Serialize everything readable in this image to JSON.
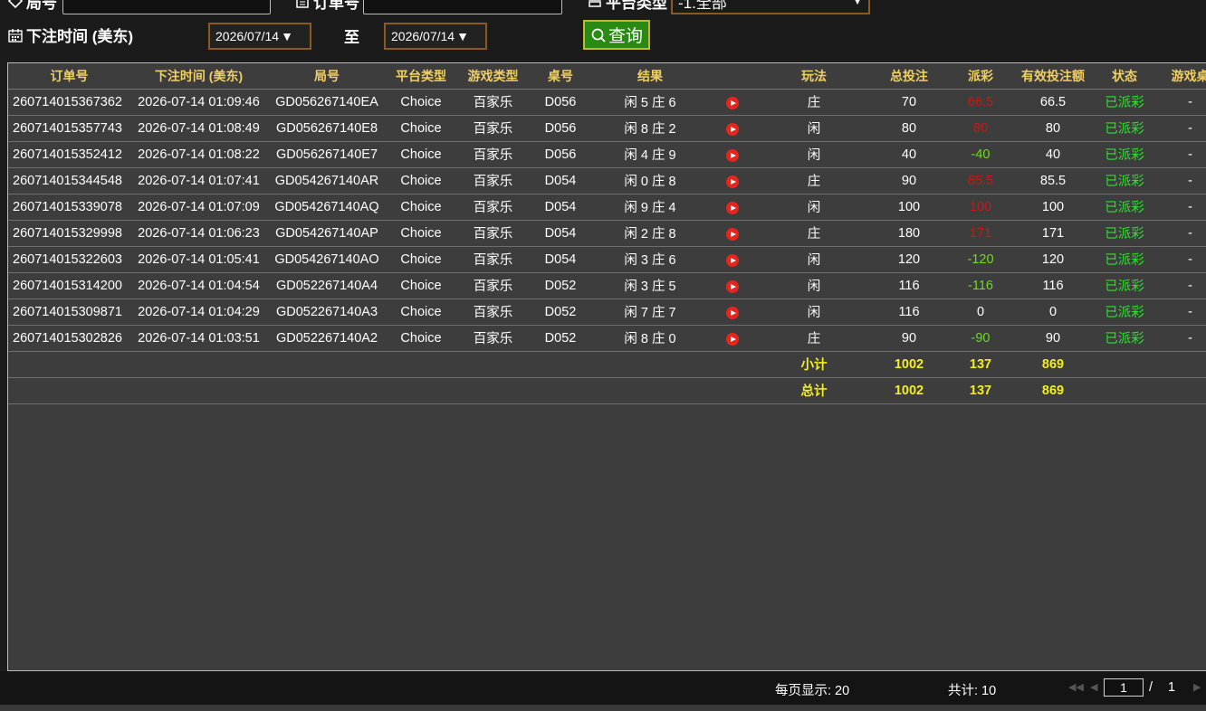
{
  "filters": {
    "round_label": "局号",
    "order_label": "订单号",
    "platform_label": "平台类型",
    "platform_value": "-1.全部",
    "time_label": "下注时间 (美东)",
    "date_from": "2026/07/14",
    "to_label": "至",
    "date_to": "2026/07/14",
    "query_label": "查询"
  },
  "table": {
    "columns": [
      "订单号",
      "下注时间 (美东)",
      "局号",
      "平台类型",
      "游戏类型",
      "桌号",
      "结果",
      "",
      "玩法",
      "总投注",
      "派彩",
      "有效投注额",
      "状态",
      "游戏桌"
    ],
    "rows": [
      {
        "order": "260714015367362",
        "time": "2026-07-14 01:09:46",
        "round": "GD056267140EA",
        "platform": "Choice",
        "game": "百家乐",
        "table": "D056",
        "result": "闲 5 庄 6",
        "play": "庄",
        "bet": "70",
        "payout": "66.5",
        "payout_type": "pos",
        "valid": "66.5",
        "status": "已派彩",
        "desk": "-"
      },
      {
        "order": "260714015357743",
        "time": "2026-07-14 01:08:49",
        "round": "GD056267140E8",
        "platform": "Choice",
        "game": "百家乐",
        "table": "D056",
        "result": "闲 8 庄 2",
        "play": "闲",
        "bet": "80",
        "payout": "80",
        "payout_type": "pos",
        "valid": "80",
        "status": "已派彩",
        "desk": "-"
      },
      {
        "order": "260714015352412",
        "time": "2026-07-14 01:08:22",
        "round": "GD056267140E7",
        "platform": "Choice",
        "game": "百家乐",
        "table": "D056",
        "result": "闲 4 庄 9",
        "play": "闲",
        "bet": "40",
        "payout": "-40",
        "payout_type": "neg",
        "valid": "40",
        "status": "已派彩",
        "desk": "-"
      },
      {
        "order": "260714015344548",
        "time": "2026-07-14 01:07:41",
        "round": "GD054267140AR",
        "platform": "Choice",
        "game": "百家乐",
        "table": "D054",
        "result": "闲 0 庄 8",
        "play": "庄",
        "bet": "90",
        "payout": "85.5",
        "payout_type": "pos",
        "valid": "85.5",
        "status": "已派彩",
        "desk": "-"
      },
      {
        "order": "260714015339078",
        "time": "2026-07-14 01:07:09",
        "round": "GD054267140AQ",
        "platform": "Choice",
        "game": "百家乐",
        "table": "D054",
        "result": "闲 9 庄 4",
        "play": "闲",
        "bet": "100",
        "payout": "100",
        "payout_type": "pos",
        "valid": "100",
        "status": "已派彩",
        "desk": "-"
      },
      {
        "order": "260714015329998",
        "time": "2026-07-14 01:06:23",
        "round": "GD054267140AP",
        "platform": "Choice",
        "game": "百家乐",
        "table": "D054",
        "result": "闲 2 庄 8",
        "play": "庄",
        "bet": "180",
        "payout": "171",
        "payout_type": "pos",
        "valid": "171",
        "status": "已派彩",
        "desk": "-"
      },
      {
        "order": "260714015322603",
        "time": "2026-07-14 01:05:41",
        "round": "GD054267140AO",
        "platform": "Choice",
        "game": "百家乐",
        "table": "D054",
        "result": "闲 3 庄 6",
        "play": "闲",
        "bet": "120",
        "payout": "-120",
        "payout_type": "neg",
        "valid": "120",
        "status": "已派彩",
        "desk": "-"
      },
      {
        "order": "260714015314200",
        "time": "2026-07-14 01:04:54",
        "round": "GD052267140A4",
        "platform": "Choice",
        "game": "百家乐",
        "table": "D052",
        "result": "闲 3 庄 5",
        "play": "闲",
        "bet": "116",
        "payout": "-116",
        "payout_type": "neg",
        "valid": "116",
        "status": "已派彩",
        "desk": "-"
      },
      {
        "order": "260714015309871",
        "time": "2026-07-14 01:04:29",
        "round": "GD052267140A3",
        "platform": "Choice",
        "game": "百家乐",
        "table": "D052",
        "result": "闲 7 庄 7",
        "play": "闲",
        "bet": "116",
        "payout": "0",
        "payout_type": "zero",
        "valid": "0",
        "status": "已派彩",
        "desk": "-"
      },
      {
        "order": "260714015302826",
        "time": "2026-07-14 01:03:51",
        "round": "GD052267140A2",
        "platform": "Choice",
        "game": "百家乐",
        "table": "D052",
        "result": "闲 8 庄 0",
        "play": "庄",
        "bet": "90",
        "payout": "-90",
        "payout_type": "neg",
        "valid": "90",
        "status": "已派彩",
        "desk": "-"
      }
    ],
    "subtotal": {
      "label": "小计",
      "bet": "1002",
      "payout": "137",
      "valid": "869"
    },
    "total": {
      "label": "总计",
      "bet": "1002",
      "payout": "137",
      "valid": "869"
    }
  },
  "footer": {
    "per_page": "每页显示: 20",
    "total": "共计: 10",
    "current_page": "1",
    "separator": "/",
    "total_pages": "1"
  },
  "colors": {
    "header_text": "#f0cf63",
    "payout_positive": "#c81818",
    "payout_negative": "#6edb21",
    "status_paid": "#2fe02f",
    "summary_text": "#f3ef1f",
    "query_button": "#2a8a14"
  }
}
